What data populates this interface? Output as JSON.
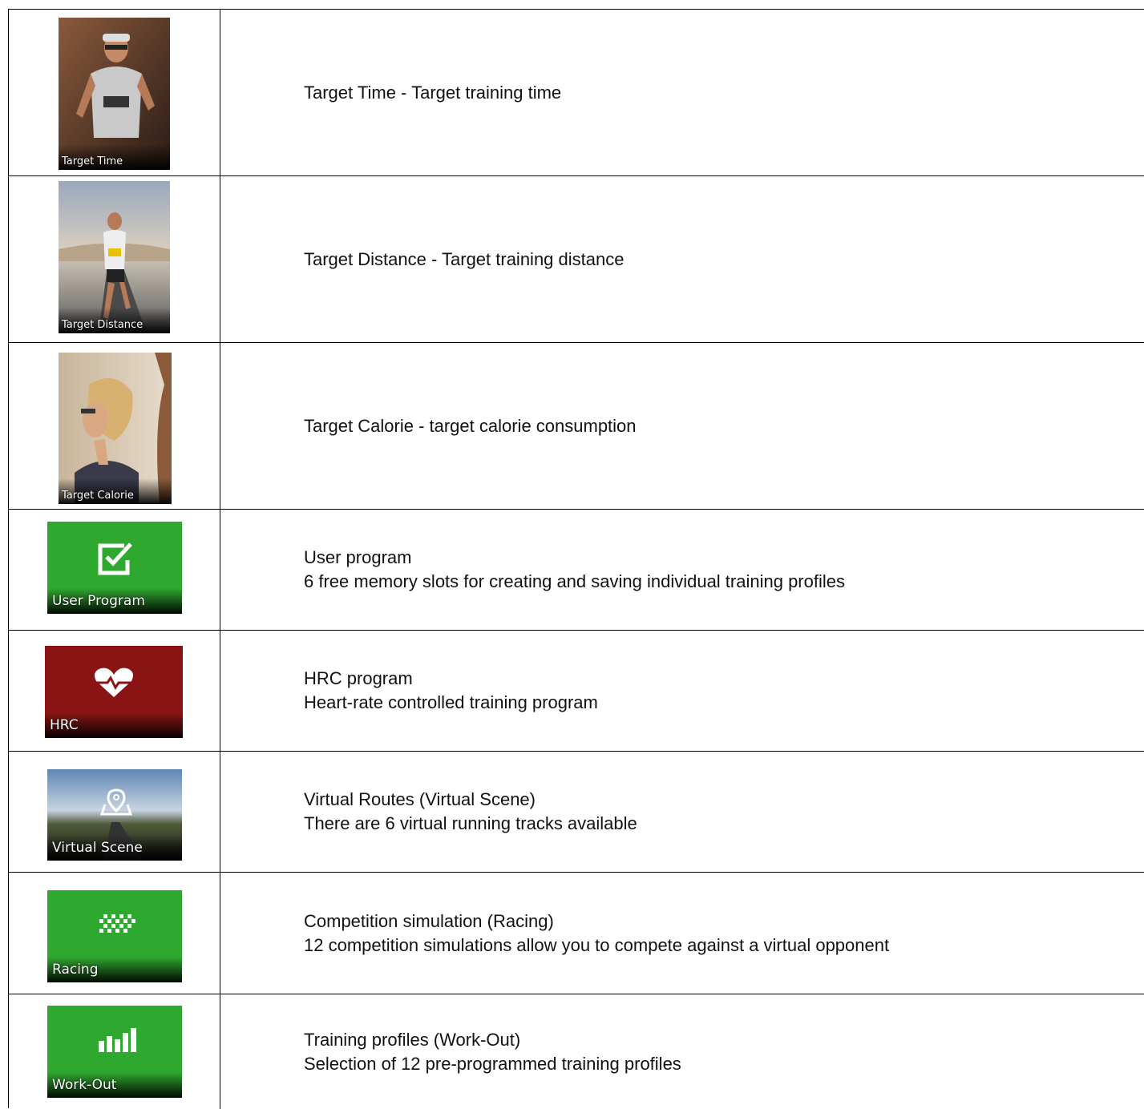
{
  "rows": [
    {
      "tile": "Target Time",
      "line1": "Target Time - Target training time",
      "line2": ""
    },
    {
      "tile": "Target Distance",
      "line1": "Target Distance - Target training distance",
      "line2": ""
    },
    {
      "tile": "Target Calorie",
      "line1": "Target Calorie - target calorie consumption",
      "line2": ""
    },
    {
      "tile": "User Program",
      "icon": "checkbox-edit-icon",
      "color": "#2fa82f",
      "line1": "User program",
      "line2": "6 free memory slots for creating and saving individual training profiles"
    },
    {
      "tile": "HRC",
      "icon": "heart-rate-icon",
      "color": "#8a1414",
      "line1": "HRC program",
      "line2": "Heart-rate controlled training program"
    },
    {
      "tile": "Virtual Scene",
      "icon": "map-pin-icon",
      "line1": "Virtual Routes (Virtual Scene)",
      "line2": "There are 6 virtual running tracks available"
    },
    {
      "tile": "Racing",
      "icon": "checkered-flag-icon",
      "color": "#2fa82f",
      "line1": "Competition simulation (Racing)",
      "line2": "12 competition simulations allow you to compete against a virtual opponent"
    },
    {
      "tile": "Work-Out",
      "icon": "bar-chart-icon",
      "color": "#2fa82f",
      "line1": "Training profiles (Work-Out)",
      "line2": "Selection of 12 pre-programmed training profiles"
    }
  ]
}
